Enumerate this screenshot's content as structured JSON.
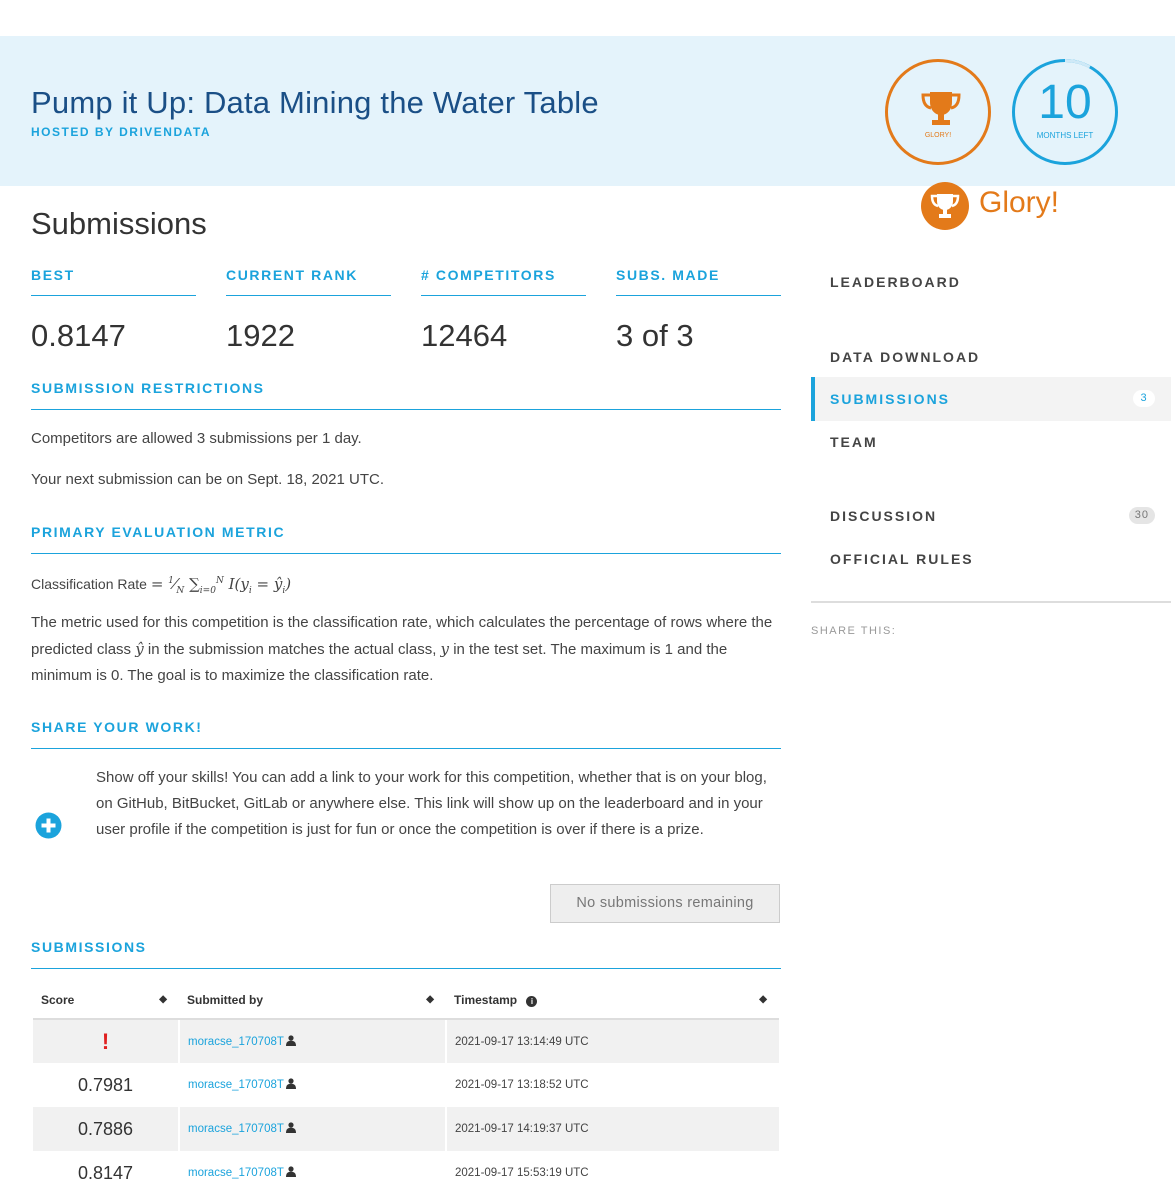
{
  "banner": {
    "title": "Pump it Up: Data Mining the Water Table",
    "host": "HOSTED BY DRIVENDATA",
    "prize_label": "GLORY!",
    "time_number": "10",
    "time_label": "MONTHS LEFT",
    "time_remaining_fraction": 0.92
  },
  "glory": {
    "text": "Glory!"
  },
  "page": {
    "title": "Submissions"
  },
  "stats": [
    {
      "label": "BEST",
      "value": "0.8147"
    },
    {
      "label": "CURRENT RANK",
      "value": "1922"
    },
    {
      "label": "# COMPETITORS",
      "value": "12464"
    },
    {
      "label": "SUBS. MADE",
      "value": "3 of 3"
    }
  ],
  "restrictions": {
    "heading": "SUBMISSION RESTRICTIONS",
    "line1": "Competitors are allowed 3 submissions per 1 day.",
    "line2": "Your next submission can be on Sept. 18, 2021 UTC."
  },
  "metric": {
    "heading": "PRIMARY EVALUATION METRIC",
    "label": "Classification Rate",
    "description_1": "The metric used for this competition is the classification rate, which calculates the percentage of rows where the predicted class",
    "description_2": "in the submission matches the actual class,",
    "description_3": "in the test set. The maximum is 1 and the minimum is 0. The goal is to maximize the classification rate.",
    "symbol_pred": "ŷ",
    "symbol_actual": "y"
  },
  "share": {
    "heading": "SHARE YOUR WORK!",
    "text": "Show off your skills! You can add a link to your work for this competition, whether that is on your blog, on GitHub, BitBucket, GitLab or anywhere else. This link will show up on the leaderboard and in your user profile if the competition is just for fun or once the competition is over if there is a prize.",
    "button_label": "No submissions remaining"
  },
  "submissions": {
    "heading": "SUBMISSIONS",
    "columns": [
      "Score",
      "Submitted by",
      "Timestamp"
    ],
    "rows": [
      {
        "score": "!",
        "user": "moracse_170708T",
        "timestamp": "2021-09-17 13:14:49 UTC",
        "error": true
      },
      {
        "score": "0.7981",
        "user": "moracse_170708T",
        "timestamp": "2021-09-17 13:18:52 UTC",
        "error": false
      },
      {
        "score": "0.7886",
        "user": "moracse_170708T",
        "timestamp": "2021-09-17 14:19:37 UTC",
        "error": false
      },
      {
        "score": "0.8147",
        "user": "moracse_170708T",
        "timestamp": "2021-09-17 15:53:19 UTC",
        "error": false
      }
    ]
  },
  "sidebar": {
    "items": [
      {
        "label": "LEADERBOARD"
      },
      {
        "label": "DATA DOWNLOAD"
      },
      {
        "label": "SUBMISSIONS",
        "badge": "3"
      },
      {
        "label": "TEAM"
      },
      {
        "label": "DISCUSSION",
        "badge": "30"
      },
      {
        "label": "OFFICIAL RULES"
      }
    ],
    "share_this": "SHARE THIS:"
  },
  "colors": {
    "accent": "#1ba3dc",
    "title": "#1a4f86",
    "prize": "#e37a1a",
    "banner_bg": "#e4f3fb",
    "error": "#e02020"
  }
}
